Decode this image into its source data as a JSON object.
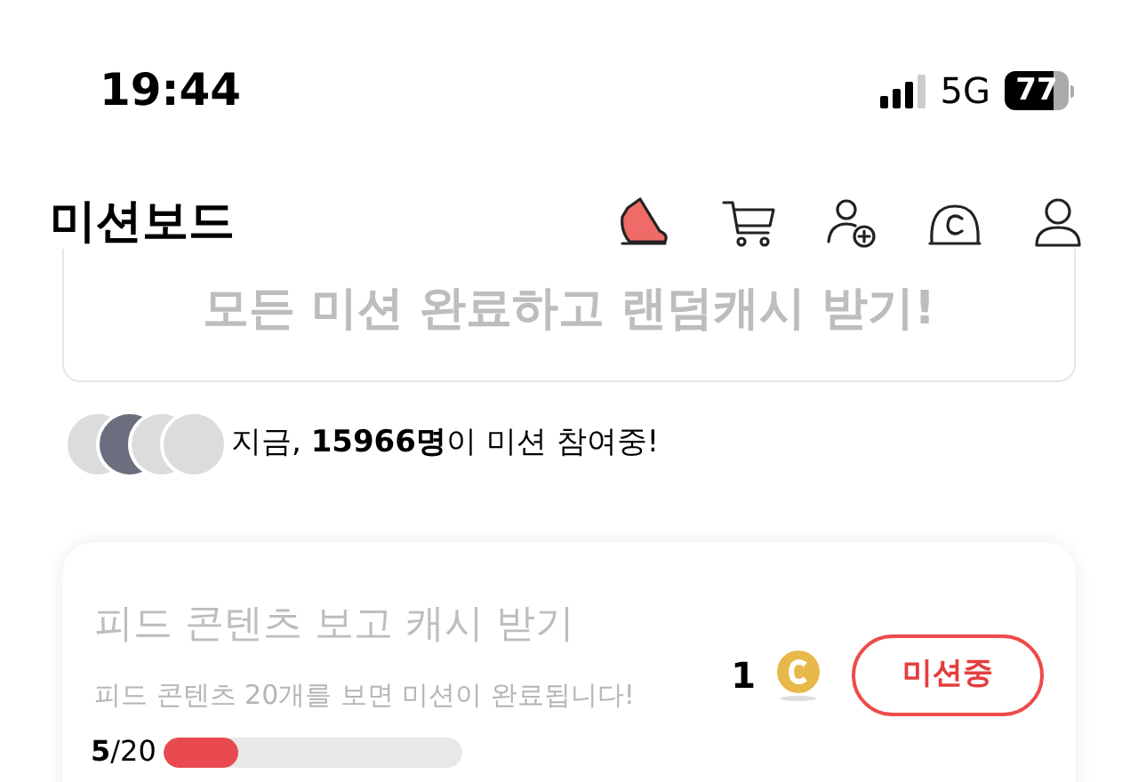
{
  "status_bar": {
    "time": "19:44",
    "network": "5G",
    "battery": "77"
  },
  "header": {
    "title": "미션보드"
  },
  "banner": {
    "text": "모든 미션 완료하고 랜덤캐시 받기!"
  },
  "participants": {
    "text": "지금, **15966명**이 미션 참여중!"
  },
  "missions": [
    {
      "title": "피드 콘텐츠 보고 캐시 받기",
      "description": "피드 콘텐츠 20개를 보면 미션이 완료됩니다!",
      "reward": "1",
      "button": "미션중",
      "progress": "**5**/20",
      "level": 0.25
    }
  ]
}
